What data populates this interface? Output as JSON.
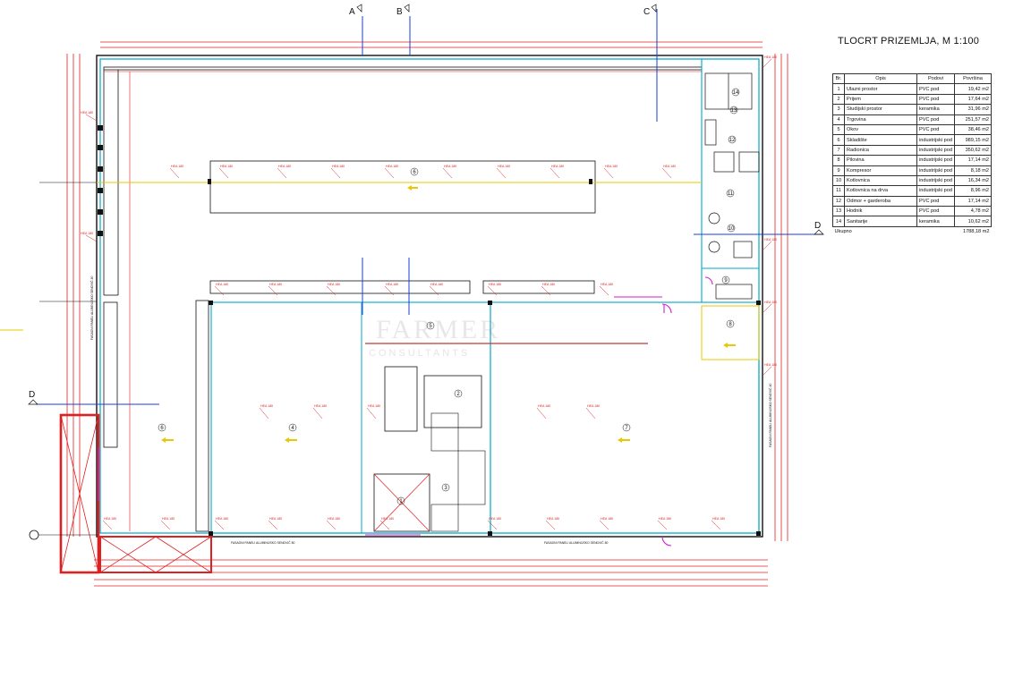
{
  "drawing": {
    "title": "TLOCRT PRIZEMLJA, M 1:100",
    "section_markers": [
      "A",
      "B",
      "C",
      "D"
    ],
    "watermark": "FARMER",
    "watermark_sub": "CONSULTANTS"
  },
  "rooms_table": {
    "headers": [
      "Br.",
      "Opis",
      "Podovi",
      "Površina"
    ],
    "rows": [
      [
        "1",
        "Ulazni prostor",
        "PVC pod",
        "19,42 m2"
      ],
      [
        "2",
        "Prijem",
        "PVC pod",
        "17,64 m2"
      ],
      [
        "3",
        "Studijski prostor",
        "keramika",
        "31,96 m2"
      ],
      [
        "4",
        "Trgovina",
        "PVC pod",
        "251,57 m2"
      ],
      [
        "5",
        "Okov",
        "PVC pod",
        "38,46 m2"
      ],
      [
        "6",
        "Skladište",
        "industrijski pod",
        "989,15 m2"
      ],
      [
        "7",
        "Radionica",
        "industrijski pod",
        "350,62 m2"
      ],
      [
        "8",
        "Pilovina",
        "industrijski pod",
        "17,14 m2"
      ],
      [
        "9",
        "Kompresor",
        "industrijski pod",
        "8,18 m2"
      ],
      [
        "10",
        "Kotlovnica",
        "industrijski pod",
        "16,34 m2"
      ],
      [
        "11",
        "Kotlovnica na drva",
        "industrijski pod",
        "8,96 m2"
      ],
      [
        "12",
        "Odmor + garderoba",
        "PVC pod",
        "17,14 m2"
      ],
      [
        "13",
        "Hodnik",
        "PVC pod",
        "4,78 m2"
      ],
      [
        "14",
        "Sanitarije",
        "keramika",
        "10,62 m2"
      ]
    ],
    "total_label": "Ukupno",
    "total_value": "1788,18 m2"
  },
  "plan_labels": {
    "beam": "HEA 180",
    "room_numbers": [
      "1",
      "2",
      "3",
      "4",
      "5",
      "6",
      "7",
      "8",
      "9",
      "10",
      "11",
      "12",
      "13",
      "14"
    ],
    "facade_note": "FASADNI PANELI ALUMINIJSKO SENDVIČ 80"
  },
  "colors": {
    "structure": "#e02020",
    "walls": "#00a8c8",
    "axis": "#1a3fd0",
    "arrows": "#e8c800",
    "doors": "#d020d0",
    "line": "#111111"
  }
}
